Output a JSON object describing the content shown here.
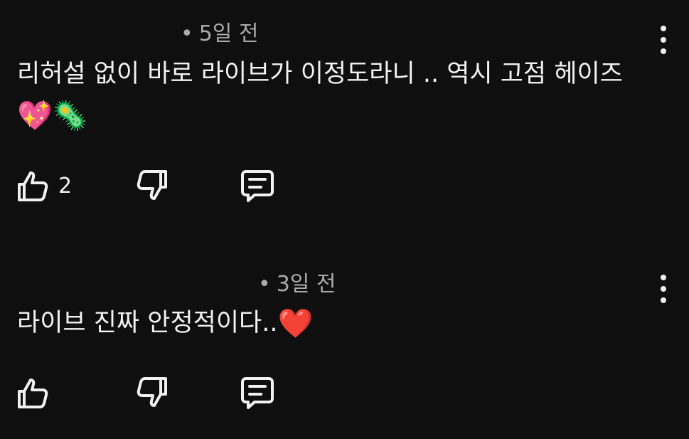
{
  "comments": [
    {
      "time_label": "5일 전",
      "separator": "•",
      "text": "리허설 없이 바로 라이브가 이정도라니 .. 역시 고점 헤이즈",
      "emojis": [
        "💖",
        "🦠"
      ],
      "like_count": "2",
      "icons": {
        "like": "thumbs-up-icon",
        "dislike": "thumbs-down-icon",
        "reply": "comment-icon",
        "menu": "more-vertical-icon"
      }
    },
    {
      "time_label": "3일 전",
      "separator": "•",
      "text": "라이브 진짜 안정적이다..",
      "emojis": [
        "❤️"
      ],
      "like_count": "",
      "icons": {
        "like": "thumbs-up-icon",
        "dislike": "thumbs-down-icon",
        "reply": "comment-icon",
        "menu": "more-vertical-icon"
      }
    }
  ],
  "colors": {
    "background": "#0f0f0f",
    "primary_text": "#f1f1f1",
    "secondary_text": "#aaaaaa"
  }
}
